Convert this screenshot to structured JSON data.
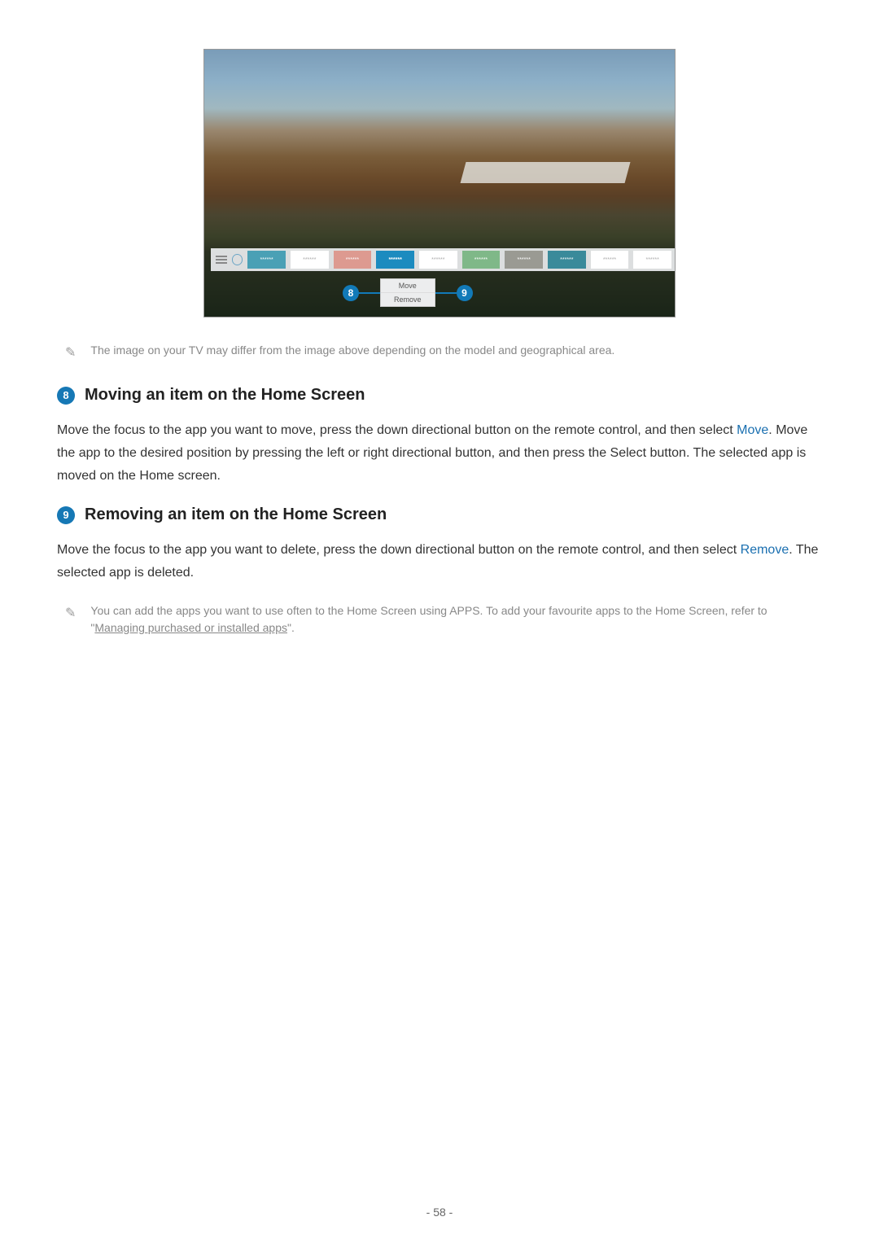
{
  "figure": {
    "tiles": [
      "******",
      "******",
      "******",
      "******",
      "******",
      "******",
      "******",
      "******",
      "******",
      "******"
    ],
    "popup": {
      "move": "Move",
      "remove": "Remove"
    },
    "callout8": "8",
    "callout9": "9"
  },
  "notes": {
    "imageDiffer": "The image on your TV may differ from the image above depending on the model and geographical area.",
    "addApps_before": "You can add the apps you want to use often to the Home Screen using APPS. To add your favourite apps to the Home Screen, refer to \"",
    "addApps_link": "Managing purchased or installed apps",
    "addApps_after": "\"."
  },
  "sections": {
    "s8": {
      "num": "8",
      "title": "Moving an item on the Home Screen",
      "body_a": "Move the focus to the app you want to move, press the down directional button on the remote control, and then select ",
      "body_hl": "Move",
      "body_b": ". Move the app to the desired position by pressing the left or right directional button, and then press the Select button. The selected app is moved on the Home screen."
    },
    "s9": {
      "num": "9",
      "title": "Removing an item on the Home Screen",
      "body_a": "Move the focus to the app you want to delete, press the down directional button on the remote control, and then select ",
      "body_hl": "Remove",
      "body_b": ". The selected app is deleted."
    }
  },
  "page": "- 58 -"
}
